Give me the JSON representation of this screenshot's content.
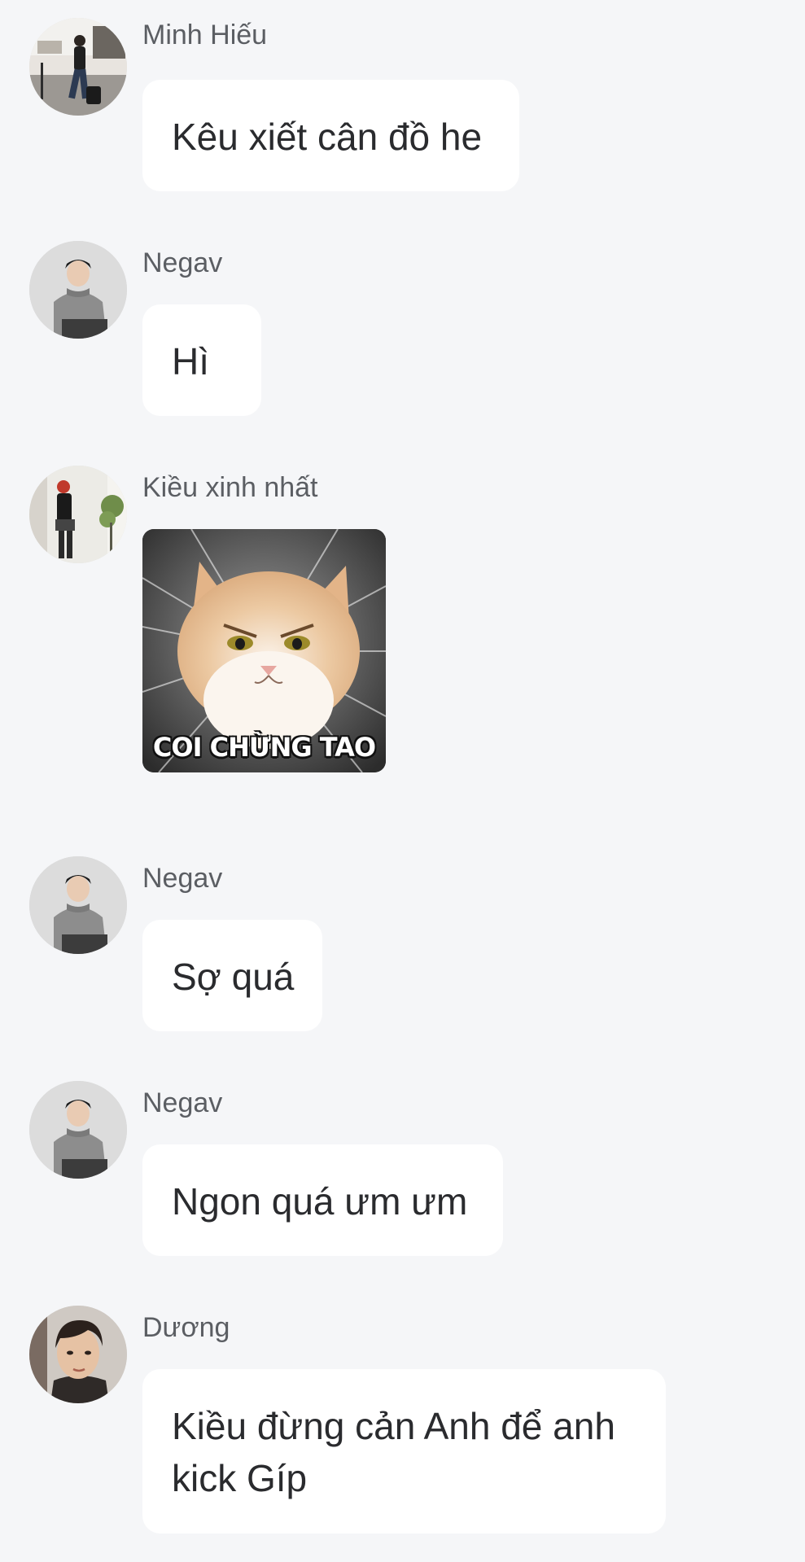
{
  "messages": [
    {
      "sender": "Minh Hiếu",
      "text": "Kêu xiết cân đồ he",
      "avatar_icon": "person-street-photo-avatar"
    },
    {
      "sender": "Negav",
      "text": "Hì",
      "avatar_icon": "person-grey-sweater-avatar"
    },
    {
      "sender": "Kiều xinh nhất",
      "sticker_caption": "COI CHỪNG TAO",
      "avatar_icon": "person-black-outfit-avatar",
      "sticker_icon": "angry-cat-sticker"
    },
    {
      "sender": "Negav",
      "text": "Sợ quá",
      "avatar_icon": "person-grey-sweater-avatar"
    },
    {
      "sender": "Negav",
      "text": "Ngon quá ưm ưm",
      "avatar_icon": "person-grey-sweater-avatar"
    },
    {
      "sender": "Dương",
      "text": "Kiều đừng cản Anh để anh kick Gíp",
      "avatar_icon": "person-portrait-avatar"
    }
  ],
  "colors": {
    "background": "#f5f6f8",
    "bubble": "#ffffff",
    "sender_name": "#5b5e63",
    "message_text": "#2a2b2e"
  }
}
